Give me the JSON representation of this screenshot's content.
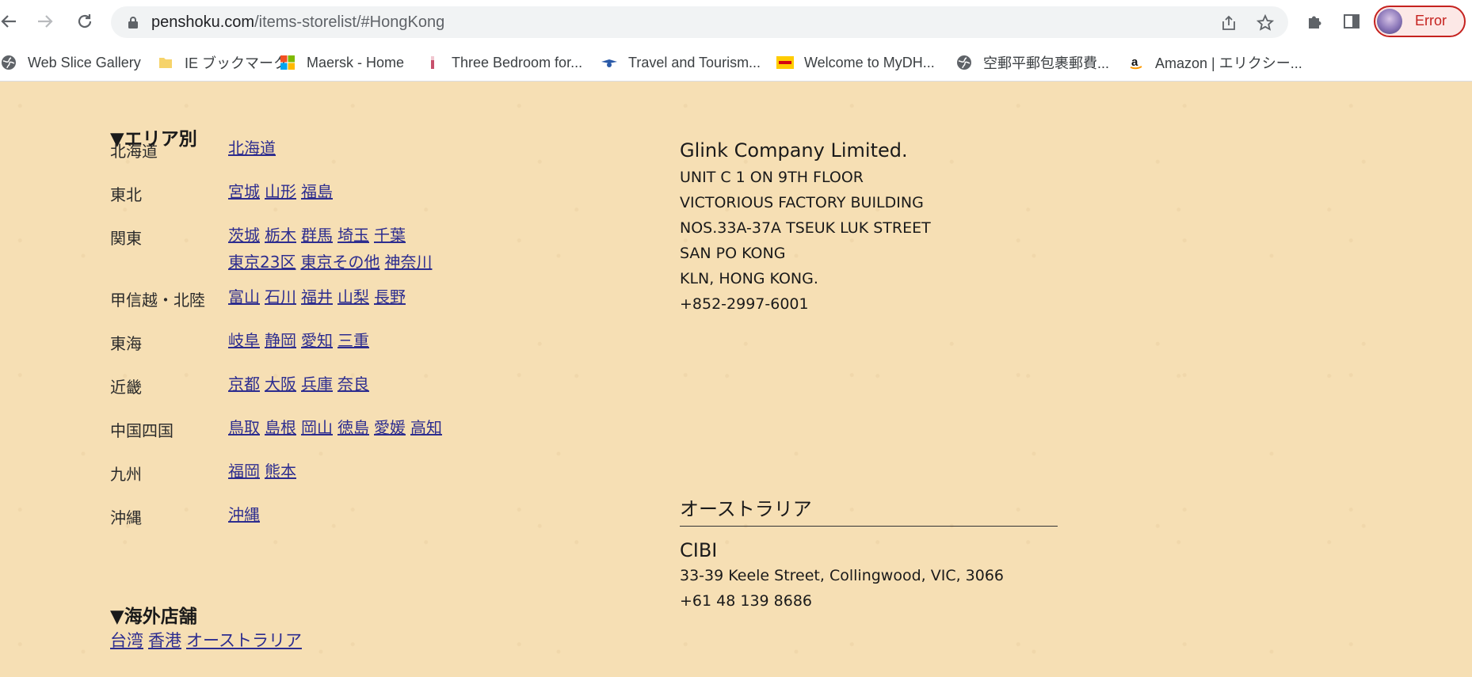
{
  "browser": {
    "url_domain": "penshoku.com",
    "url_path": "/items-storelist/#HongKong",
    "profile_status": "Error"
  },
  "bookmarks": [
    {
      "label": "Web Slice Gallery",
      "icon": "globe-icon"
    },
    {
      "label": "IE ブックマーク",
      "icon": "folder-icon"
    },
    {
      "label": "Maersk - Home",
      "icon": "microsoft-icon"
    },
    {
      "label": "Three Bedroom for...",
      "icon": "site-icon"
    },
    {
      "label": "Travel and Tourism...",
      "icon": "airline-icon"
    },
    {
      "label": "Welcome to MyDH...",
      "icon": "dhl-icon"
    },
    {
      "label": "空郵平郵包裹郵費...",
      "icon": "globe-icon"
    },
    {
      "label": "Amazon | エリクシー...",
      "icon": "amazon-icon"
    }
  ],
  "area_section": {
    "title": "▼エリア別",
    "regions": [
      {
        "label": "北海道",
        "prefectures": [
          "北海道"
        ]
      },
      {
        "label": "東北",
        "prefectures": [
          "宮城",
          "山形",
          "福島"
        ]
      },
      {
        "label": "関東",
        "prefectures": [
          "茨城",
          "栃木",
          "群馬",
          "埼玉",
          "千葉",
          "東京23区",
          "東京その他",
          "神奈川"
        ]
      },
      {
        "label": "甲信越・北陸",
        "prefectures": [
          "富山",
          "石川",
          "福井",
          "山梨",
          "長野"
        ]
      },
      {
        "label": "東海",
        "prefectures": [
          "岐阜",
          "静岡",
          "愛知",
          "三重"
        ]
      },
      {
        "label": "近畿",
        "prefectures": [
          "京都",
          "大阪",
          "兵庫",
          "奈良"
        ]
      },
      {
        "label": "中国四国",
        "prefectures": [
          "鳥取",
          "島根",
          "岡山",
          "徳島",
          "愛媛",
          "高知"
        ]
      },
      {
        "label": "九州",
        "prefectures": [
          "福岡",
          "熊本"
        ]
      },
      {
        "label": "沖縄",
        "prefectures": [
          "沖縄"
        ]
      }
    ]
  },
  "overseas_section": {
    "title": "▼海外店舗",
    "links": [
      "台湾",
      "香港",
      "オーストラリア"
    ]
  },
  "hongkong_store": {
    "name": "Glink Company Limited.",
    "address": [
      "UNIT C 1 ON 9TH FLOOR",
      "VICTORIOUS FACTORY BUILDING",
      "NOS.33A-37A TSEUK LUK STREET",
      "SAN PO KONG",
      "KLN, HONG KONG.",
      "+852-2997-6001"
    ]
  },
  "australia": {
    "heading": "オーストラリア",
    "store_name": "CIBI",
    "address": "33-39 Keele Street, Collingwood, VIC, 3066",
    "phone": "+61 48 139 8686"
  }
}
